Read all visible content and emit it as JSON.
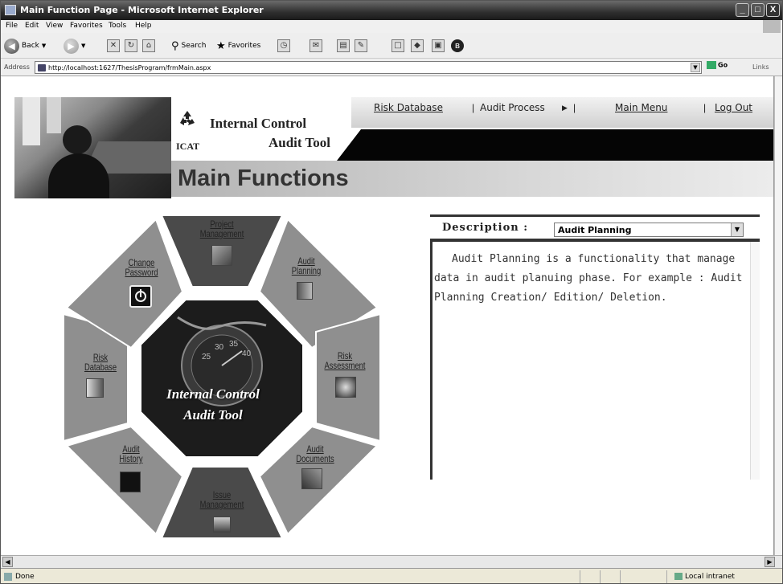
{
  "window": {
    "title": "Main Function Page - Microsoft Internet Explorer",
    "minimize": "_",
    "maximize": "□",
    "close": "X"
  },
  "menu": {
    "items": [
      "File",
      "Edit",
      "View",
      "Favorites",
      "Tools",
      "Help"
    ]
  },
  "toolbar": {
    "back": "Back",
    "search": "Search",
    "favorites": "Favorites"
  },
  "address": {
    "label": "Address",
    "url": "http://localhost:1627/ThesisProgram/frmMain.aspx",
    "go": "Go",
    "links": "Links"
  },
  "header": {
    "logo_line1": "Internal Control",
    "logo_line2": "Audit Tool",
    "logo_abbr": "ICAT",
    "title": "Main Functions",
    "nav": {
      "risk_database": "Risk Database",
      "sep1": "|",
      "audit_process": "Audit Process",
      "audit_process_arrow": "▶",
      "sep2": "|",
      "main_menu": "Main Menu",
      "sep3": "|",
      "log_out": "Log Out"
    }
  },
  "wheel": {
    "center_line1": "Internal Control",
    "center_line2": "Audit Tool",
    "sectors": {
      "project_management": [
        "Project",
        "Management"
      ],
      "audit_planning": [
        "Audit",
        "Planning"
      ],
      "risk_assessment": [
        "Risk",
        "Assessment"
      ],
      "audit_documents": [
        "Audit",
        "Documents"
      ],
      "issue_management": [
        "Issue",
        "Management"
      ],
      "audit_history": [
        "Audit",
        "History"
      ],
      "risk_database": [
        "Risk",
        "Database"
      ],
      "change_password": [
        "Change",
        "Password"
      ]
    }
  },
  "description": {
    "label": "Description :",
    "selected": "Audit Planning",
    "text": "Audit Planning is a functionality that manage data in audit planuing phase. For example : Audit Planning Creation/ Edition/ Deletion."
  },
  "status": {
    "text": "Done",
    "zone": "Local intranet"
  },
  "colors": {
    "title_bar": "#2e2e2e",
    "sector_dark": "#4a4a4a",
    "sector_light": "#8f8f8f",
    "center_bg": "#1c1c1c"
  },
  "icons": [
    "ie-window-icon",
    "back-icon",
    "forward-icon",
    "stop-icon",
    "refresh-icon",
    "home-icon",
    "search-icon",
    "favorites-icon",
    "recycle-logo-icon"
  ]
}
